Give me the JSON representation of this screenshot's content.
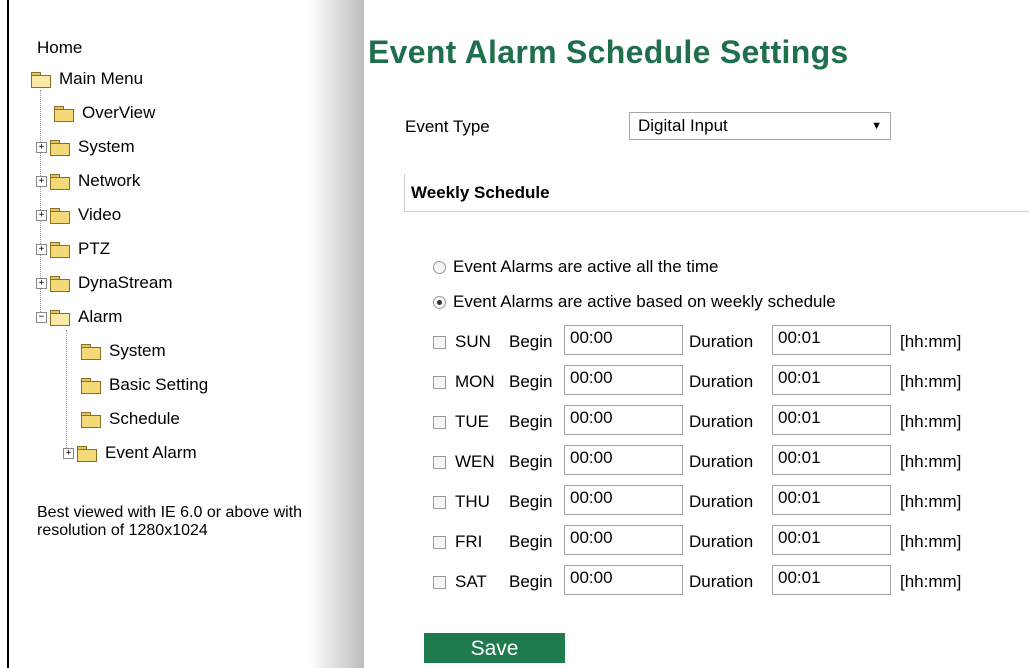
{
  "sidebar": {
    "home": "Home",
    "main_menu": "Main Menu",
    "items": [
      {
        "label": "OverView"
      },
      {
        "label": "System"
      },
      {
        "label": "Network"
      },
      {
        "label": "Video"
      },
      {
        "label": "PTZ"
      },
      {
        "label": "DynaStream"
      },
      {
        "label": "Alarm"
      }
    ],
    "alarm_children": [
      {
        "label": "System"
      },
      {
        "label": "Basic Setting"
      },
      {
        "label": "Schedule"
      },
      {
        "label": "Event Alarm"
      }
    ],
    "note": "Best viewed with IE 6.0 or above with resolution of 1280x1024"
  },
  "page": {
    "title": "Event Alarm Schedule Settings",
    "event_type_label": "Event Type",
    "event_type_value": "Digital Input",
    "weekly_schedule_label": "Weekly Schedule",
    "radio_all_time": "Event Alarms are active all the time",
    "radio_weekly": "Event Alarms are active based on weekly schedule",
    "selected_mode": "weekly",
    "begin_label": "Begin",
    "duration_label": "Duration",
    "unit_label": "[hh:mm]",
    "days": [
      {
        "day": "SUN",
        "begin": "00:00",
        "duration": "00:01",
        "checked": false
      },
      {
        "day": "MON",
        "begin": "00:00",
        "duration": "00:01",
        "checked": false
      },
      {
        "day": "TUE",
        "begin": "00:00",
        "duration": "00:01",
        "checked": false
      },
      {
        "day": "WEN",
        "begin": "00:00",
        "duration": "00:01",
        "checked": false
      },
      {
        "day": "THU",
        "begin": "00:00",
        "duration": "00:01",
        "checked": false
      },
      {
        "day": "FRI",
        "begin": "00:00",
        "duration": "00:01",
        "checked": false
      },
      {
        "day": "SAT",
        "begin": "00:00",
        "duration": "00:01",
        "checked": false
      }
    ],
    "save_label": "Save"
  },
  "colors": {
    "title_green": "#1f6e4c",
    "save_green": "#1f7b4d"
  }
}
